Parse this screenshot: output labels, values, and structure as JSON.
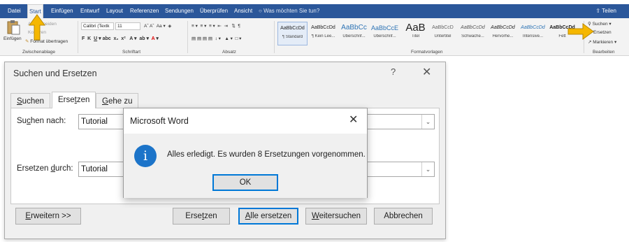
{
  "ribbon": {
    "tabs": [
      "Datei",
      "Start",
      "Einfügen",
      "Entwurf",
      "Layout",
      "Referenzen",
      "Sendungen",
      "Überprüfen",
      "Ansicht"
    ],
    "active_tab": "Start",
    "tell_me": "Was möchten Sie tun?",
    "share": "Teilen",
    "clipboard": {
      "paste": "Einfügen",
      "cut": "Ausschneiden",
      "copy": "Kopieren",
      "format_painter": "Format übertragen",
      "group": "Zwischenablage"
    },
    "font": {
      "name": "Calibri (Textk",
      "size": "11",
      "group": "Schriftart"
    },
    "paragraph": {
      "group": "Absatz"
    },
    "styles": {
      "group": "Formatvorlagen",
      "items": [
        {
          "sample": "AaBbCcDd",
          "name": "¶ Standard"
        },
        {
          "sample": "AaBbCcDd",
          "name": "¶ Kein Lee..."
        },
        {
          "sample": "AaBbCc",
          "name": "Überschrif..."
        },
        {
          "sample": "AaBbCcE",
          "name": "Überschrif..."
        },
        {
          "sample": "AaB",
          "name": "Titel"
        },
        {
          "sample": "AaBbCcD",
          "name": "Untertitel"
        },
        {
          "sample": "AaBbCcDd",
          "name": "Schwache..."
        },
        {
          "sample": "AaBbCcDd",
          "name": "Hervorhe..."
        },
        {
          "sample": "AaBbCcDd",
          "name": "Intensive..."
        },
        {
          "sample": "AaBbCcDd",
          "name": "Fett"
        }
      ]
    },
    "editing": {
      "find": "Suchen",
      "replace": "Ersetzen",
      "select": "Markieren",
      "group": "Bearbeiten"
    }
  },
  "find_dialog": {
    "title": "Suchen und Ersetzen",
    "help": "?",
    "close": "✕",
    "tabs": [
      "Suchen",
      "Ersetzen",
      "Gehe zu"
    ],
    "active_tab": "Ersetzen",
    "find_label": "Suchen nach:",
    "find_value": "Tutorial",
    "replace_label": "Ersetzen durch:",
    "replace_value": "Tutorial",
    "buttons": {
      "more": "Erweitern >>",
      "replace": "Ersetzen",
      "replace_all": "Alle ersetzen",
      "find_next": "Weitersuchen",
      "cancel": "Abbrechen"
    }
  },
  "message_box": {
    "title": "Microsoft Word",
    "close": "✕",
    "icon": "i",
    "text": "Alles erledigt. Es wurden 8 Ersetzungen vorgenommen.",
    "ok": "OK"
  },
  "colors": {
    "ribbon_blue": "#2b579a",
    "accent": "#0078d7",
    "info_icon": "#1c74c9",
    "arrow": "#f5b700"
  }
}
